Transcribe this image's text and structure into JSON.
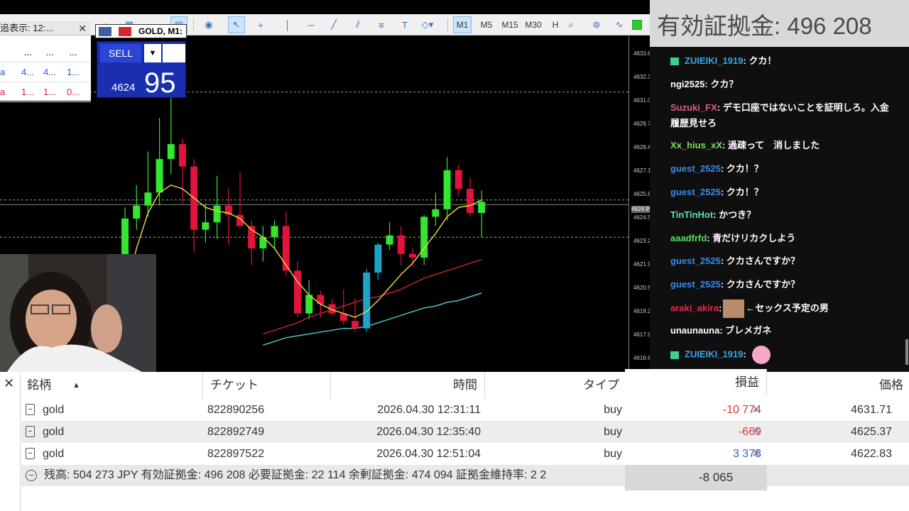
{
  "toolbar": {
    "timeframes": [
      "M1",
      "M5",
      "M15",
      "M30",
      "H"
    ],
    "selected_timeframe": "M1"
  },
  "market_watch": {
    "tab_label": "追表示: 12:...",
    "close_label": "✕",
    "rows": [
      {
        "c1": "",
        "c2": "...",
        "c3": "...",
        "c4": "..."
      },
      {
        "c1": "a",
        "c2": "4...",
        "c3": "4...",
        "c4": "1..."
      },
      {
        "c1": "a",
        "c2": "1...",
        "c3": "1...",
        "c4": "0..."
      }
    ]
  },
  "chart": {
    "title": "GOLD, M1:",
    "sell_label": "SELL",
    "price_prefix": "4624",
    "price_big": "95",
    "price_ticks": [
      "4633.65",
      "4632.35",
      "4631.05",
      "4629.75",
      "4628.45",
      "4627.15",
      "4625.85",
      "4624.55",
      "4623.25",
      "4621.95",
      "4620.55",
      "4619.25",
      "4617.95",
      "4616.65"
    ],
    "current_price_label": "4624.95"
  },
  "chart_data": {
    "type": "candlestick",
    "title": "GOLD, M1:",
    "ylim": [
      4616.0,
      4634.0
    ],
    "candles": [
      {
        "o": 4620.5,
        "h": 4624.8,
        "l": 4620.2,
        "c": 4624.2
      },
      {
        "o": 4624.2,
        "h": 4626.0,
        "l": 4623.6,
        "c": 4624.9
      },
      {
        "o": 4624.9,
        "h": 4627.8,
        "l": 4624.3,
        "c": 4625.6
      },
      {
        "o": 4625.6,
        "h": 4629.6,
        "l": 4624.9,
        "c": 4627.4
      },
      {
        "o": 4627.4,
        "h": 4631.2,
        "l": 4626.6,
        "c": 4628.2
      },
      {
        "o": 4628.2,
        "h": 4628.5,
        "l": 4625.0,
        "c": 4627.0
      },
      {
        "o": 4627.0,
        "h": 4627.4,
        "l": 4622.4,
        "c": 4623.6
      },
      {
        "o": 4623.6,
        "h": 4625.0,
        "l": 4622.9,
        "c": 4624.0
      },
      {
        "o": 4624.0,
        "h": 4626.5,
        "l": 4623.1,
        "c": 4624.9
      },
      {
        "o": 4624.9,
        "h": 4625.8,
        "l": 4622.8,
        "c": 4624.4
      },
      {
        "o": 4624.4,
        "h": 4626.7,
        "l": 4624.1,
        "c": 4623.8
      },
      {
        "o": 4623.8,
        "h": 4624.1,
        "l": 4621.7,
        "c": 4622.6
      },
      {
        "o": 4622.6,
        "h": 4623.8,
        "l": 4621.9,
        "c": 4623.2
      },
      {
        "o": 4623.2,
        "h": 4624.1,
        "l": 4622.6,
        "c": 4623.8
      },
      {
        "o": 4623.8,
        "h": 4624.6,
        "l": 4621.1,
        "c": 4621.4
      },
      {
        "o": 4621.4,
        "h": 4621.9,
        "l": 4618.9,
        "c": 4619.1
      },
      {
        "o": 4619.1,
        "h": 4620.9,
        "l": 4618.8,
        "c": 4620.1
      },
      {
        "o": 4620.1,
        "h": 4620.3,
        "l": 4618.9,
        "c": 4619.6
      },
      {
        "o": 4619.6,
        "h": 4619.9,
        "l": 4619.0,
        "c": 4619.1
      },
      {
        "o": 4619.1,
        "h": 4620.4,
        "l": 4618.5,
        "c": 4618.7
      },
      {
        "o": 4618.7,
        "h": 4619.9,
        "l": 4618.1,
        "c": 4618.3
      },
      {
        "o": 4618.3,
        "h": 4621.5,
        "l": 4618.1,
        "c": 4621.3
      },
      {
        "o": 4621.3,
        "h": 4622.9,
        "l": 4620.9,
        "c": 4622.8
      },
      {
        "o": 4622.8,
        "h": 4624.0,
        "l": 4622.5,
        "c": 4623.3
      },
      {
        "o": 4623.3,
        "h": 4623.8,
        "l": 4621.7,
        "c": 4622.3
      },
      {
        "o": 4622.3,
        "h": 4622.6,
        "l": 4621.6,
        "c": 4622.1
      },
      {
        "o": 4622.1,
        "h": 4624.4,
        "l": 4621.7,
        "c": 4624.3
      },
      {
        "o": 4624.3,
        "h": 4625.6,
        "l": 4623.8,
        "c": 4624.7
      },
      {
        "o": 4624.7,
        "h": 4627.5,
        "l": 4624.1,
        "c": 4626.8
      },
      {
        "o": 4626.8,
        "h": 4627.1,
        "l": 4625.4,
        "c": 4625.8
      },
      {
        "o": 4625.8,
        "h": 4626.4,
        "l": 4624.3,
        "c": 4624.5
      },
      {
        "o": 4624.5,
        "h": 4625.7,
        "l": 4623.2,
        "c": 4625.1
      }
    ],
    "candle_colors": {
      "up": "#32e632",
      "down": "#e0143c",
      "bull_alt": "#1ba6c8"
    },
    "ma_fast": [
      4620.0,
      4622.6,
      4624.5,
      4625.6,
      4626.0,
      4625.8,
      4625.3,
      4624.8,
      4624.6,
      4624.5,
      4624.2,
      4623.6,
      4623.2,
      4622.6,
      4621.7,
      4620.8,
      4620.1,
      4619.6,
      4619.3,
      4619.1,
      4618.9,
      4619.2,
      4619.8,
      4620.5,
      4621.2,
      4621.8,
      4622.6,
      4623.4,
      4624.3,
      4624.8,
      4624.9,
      4625.2
    ],
    "ma_slow": [
      null,
      null,
      null,
      null,
      null,
      null,
      null,
      null,
      null,
      null,
      null,
      null,
      4618.0,
      4618.2,
      4618.4,
      4618.6,
      4618.9,
      4619.1,
      4619.3,
      4619.5,
      4619.7,
      4619.9,
      4620.0,
      4620.2,
      4620.4,
      4620.7,
      4621.0,
      4621.2,
      4621.4,
      4621.6,
      4621.8,
      4622.0
    ],
    "ma_slowest": [
      null,
      null,
      null,
      null,
      null,
      null,
      null,
      null,
      null,
      null,
      null,
      null,
      4617.4,
      4617.6,
      4617.8,
      4617.9,
      4618.0,
      4618.1,
      4618.2,
      4618.3,
      4618.3,
      4618.4,
      4618.6,
      4618.8,
      4619.0,
      4619.2,
      4619.4,
      4619.5,
      4619.7,
      4619.8,
      4620.0,
      4620.2
    ],
    "ma_colors": [
      "#e6d23a",
      "#c0242a",
      "#4ac6cc"
    ],
    "hlines": [
      4631.0,
      4625.2,
      4624.95,
      4623.2
    ]
  },
  "chat": {
    "header": "有効証拠金: 496 208",
    "messages": [
      {
        "user": "ZUIEIKI_1919",
        "text": ": クカ！",
        "color": "#3aa7e8",
        "gift": true
      },
      {
        "user": "ngi2525",
        "text": ": クカ？",
        "color": "#ffffff"
      },
      {
        "user": "Suzuki_FX",
        "text": ": デモ口座ではないことを証明しろ。入金履歴見せろ",
        "color": "#e05a8a"
      },
      {
        "user": "Xx_hius_xX",
        "text": ": 過疎って　消しました",
        "color": "#7ee05a"
      },
      {
        "user": "guest_2525",
        "text": ": クカ！？",
        "color": "#3a8ae8"
      },
      {
        "user": "guest_2525",
        "text": ": クカ！？",
        "color": "#3a8ae8"
      },
      {
        "user": "TinTinHot",
        "text": ": かつき？",
        "color": "#5ae0b4"
      },
      {
        "user": "aaadfrfd",
        "text": ": 青だけリカクしよう",
        "color": "#5ae05a"
      },
      {
        "user": "guest_2525",
        "text": ": クカさんですか？",
        "color": "#3a8ae8"
      },
      {
        "user": "guest_2525",
        "text": ": クカさんですか？",
        "color": "#3a8ae8"
      },
      {
        "user": "araki_akira",
        "text": "←セックス予定の男",
        "color": "#e0304a",
        "face": true
      },
      {
        "user": "unaunauna",
        "text": ": ブレメガネ",
        "color": "#ffffff"
      },
      {
        "user": "ZUIEIKI_1919",
        "text": ":",
        "color": "#3aa7e8",
        "gift": true,
        "sticker": true
      }
    ]
  },
  "positions": {
    "close_label": "✕",
    "headers": {
      "symbol": "銘柄",
      "ticket": "チケット",
      "time": "時間",
      "type": "タイプ",
      "profit": "損益",
      "price": "価格"
    },
    "rows": [
      {
        "symbol": "gold",
        "ticket": "822890256",
        "time": "2026.04.30 12:31:11",
        "type": "buy",
        "profit": "-10 774",
        "profit_color": "#e03030",
        "price": "4631.71"
      },
      {
        "symbol": "gold",
        "ticket": "822892749",
        "time": "2026.04.30 12:35:40",
        "type": "buy",
        "profit": "-669",
        "profit_color": "#e03030",
        "price": "4625.37"
      },
      {
        "symbol": "gold",
        "ticket": "822897522",
        "time": "2026.04.30 12:51:04",
        "type": "buy",
        "profit": "3 378",
        "profit_color": "#2a5fd0",
        "price": "4622.83"
      }
    ],
    "summary": "残高: 504 273 JPY  有効証拠金: 496 208  必要証拠金: 22 114  余剰証拠金: 474 094  証拠金維持率: 2 2",
    "total_profit": "-8 065"
  }
}
